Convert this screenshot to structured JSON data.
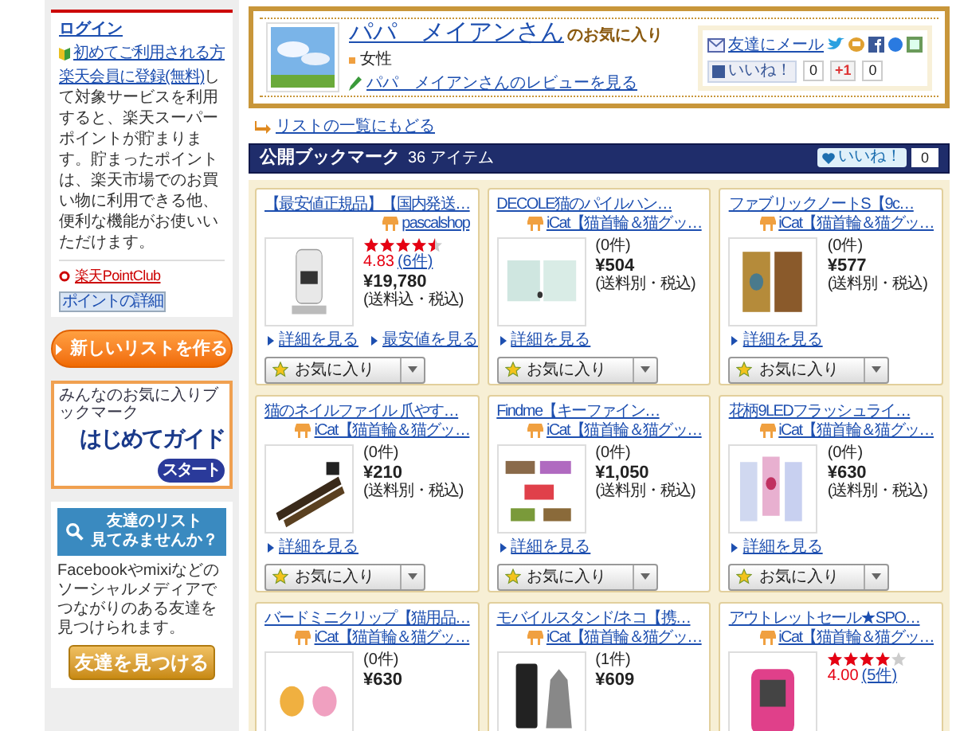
{
  "sidebar": {
    "login": {
      "title": "ログイン",
      "first_time_link": "初めてご利用される方",
      "register_link": "楽天会員に登録(無料)",
      "description": "して対象サービスを利用すると、楽天スーパーポイントが貯まります。貯まったポイントは、楽天市場でのお買い物に利用できる他、便利な機能がお使いいただけます。",
      "pointclub_link": "楽天PointClub",
      "point_detail_button": "ポイントの詳細"
    },
    "new_list_button": "新しいリストを作る",
    "guide_banner": {
      "caption": "みんなのお気に入りブックマーク",
      "title": "はじめてガイド",
      "start_button": "スタート"
    },
    "friends": {
      "title_lines": [
        "友達のリスト",
        "見てみませんか？"
      ],
      "description": "Facebookやmixiなどのソーシャルメディアでつながりのある友達を見つけられます。",
      "find_button": "友達を見つける"
    }
  },
  "profile": {
    "name": "パパ　メイアンさん",
    "suffix": "のお気に入り",
    "gender": "女性",
    "review_link": "パパ　メイアンさんのレビューを見る",
    "share": {
      "mail_link": "友達にメール",
      "like_button": "いいね！",
      "like_count": "0",
      "plusone_button": "+1",
      "plusone_count": "0"
    }
  },
  "back_link": "リストの一覧にもどる",
  "bookmarks": {
    "title": "公開ブックマーク",
    "count": "36 アイテム",
    "like_button": "いいね！",
    "like_count": "0"
  },
  "items": [
    {
      "title": "【最安値正規品】【国内発送…",
      "shop": "pascalshop",
      "stars": 4.5,
      "rating": "4.83",
      "reviews": "(6件)",
      "price": "¥19,780",
      "shipping": "(送料込・税込)",
      "links": [
        "詳細を見る",
        "最安値を見る"
      ],
      "button": "お気に入り"
    },
    {
      "title": "DECOLE猫のパイルハン…",
      "shop": "iCat【猫首輪＆猫グッ…",
      "reviews": "(0件)",
      "price": "¥504",
      "shipping": "(送料別・税込)",
      "links": [
        "詳細を見る"
      ],
      "button": "お気に入り"
    },
    {
      "title": "ファブリックノートS【9c…",
      "shop": "iCat【猫首輪＆猫グッ…",
      "reviews": "(0件)",
      "price": "¥577",
      "shipping": "(送料別・税込)",
      "links": [
        "詳細を見る"
      ],
      "button": "お気に入り"
    },
    {
      "title": "猫のネイルファイル 爪やす…",
      "shop": "iCat【猫首輪＆猫グッ…",
      "reviews": "(0件)",
      "price": "¥210",
      "shipping": "(送料別・税込)",
      "links": [
        "詳細を見る"
      ],
      "button": "お気に入り"
    },
    {
      "title": "Findme【キーファイン…",
      "shop": "iCat【猫首輪＆猫グッ…",
      "reviews": "(0件)",
      "price": "¥1,050",
      "shipping": "(送料別・税込)",
      "links": [
        "詳細を見る"
      ],
      "button": "お気に入り"
    },
    {
      "title": "花柄9LEDフラッシュライ…",
      "shop": "iCat【猫首輪＆猫グッ…",
      "reviews": "(0件)",
      "price": "¥630",
      "shipping": "(送料別・税込)",
      "links": [
        "詳細を見る"
      ],
      "button": "お気に入り"
    },
    {
      "title": "バードミニクリップ【猫用品…",
      "shop": "iCat【猫首輪＆猫グッ…",
      "reviews": "(0件)",
      "price": "¥630"
    },
    {
      "title": "モバイルスタンド/ネコ【携…",
      "shop": "iCat【猫首輪＆猫グッ…",
      "reviews": "(1件)",
      "price": "¥609"
    },
    {
      "title": "アウトレットセール★SPO…",
      "shop": "iCat【猫首輪＆猫グッ…",
      "stars": 4,
      "rating": "4.00",
      "reviews": "(5件)"
    }
  ]
}
